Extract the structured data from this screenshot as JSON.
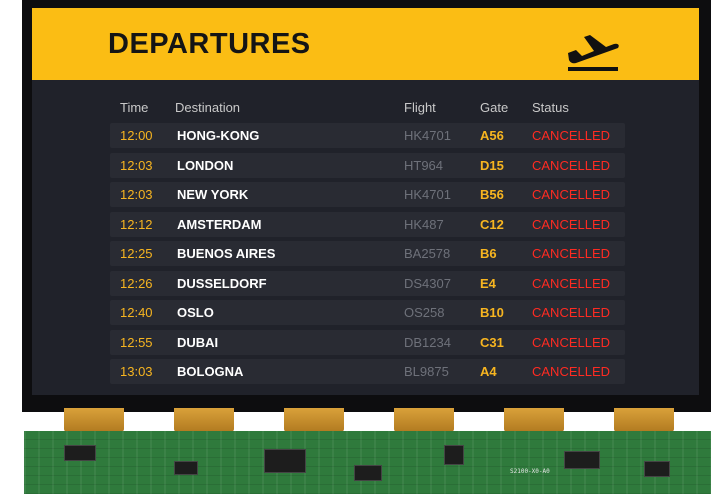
{
  "board": {
    "title": "DEPARTURES",
    "columns": {
      "time": "Time",
      "destination": "Destination",
      "flight": "Flight",
      "gate": "Gate",
      "status": "Status"
    },
    "rows": [
      {
        "time": "12:00",
        "destination": "HONG-KONG",
        "flight": "HK4701",
        "gate": "A56",
        "status": "CANCELLED"
      },
      {
        "time": "12:03",
        "destination": "LONDON",
        "flight": "HT964",
        "gate": "D15",
        "status": "CANCELLED"
      },
      {
        "time": "12:03",
        "destination": "NEW YORK",
        "flight": "HK4701",
        "gate": "B56",
        "status": "CANCELLED"
      },
      {
        "time": "12:12",
        "destination": "AMSTERDAM",
        "flight": "HK487",
        "gate": "C12",
        "status": "CANCELLED"
      },
      {
        "time": "12:25",
        "destination": "BUENOS AIRES",
        "flight": "BA2578",
        "gate": "B6",
        "status": "CANCELLED"
      },
      {
        "time": "12:26",
        "destination": "DUSSELDORF",
        "flight": "DS4307",
        "gate": "E4",
        "status": "CANCELLED"
      },
      {
        "time": "12:40",
        "destination": "OSLO",
        "flight": "OS258",
        "gate": "B10",
        "status": "CANCELLED"
      },
      {
        "time": "12:55",
        "destination": "DUBAI",
        "flight": "DB1234",
        "gate": "C31",
        "status": "CANCELLED"
      },
      {
        "time": "13:03",
        "destination": "BOLOGNA",
        "flight": "BL9875",
        "gate": "A4",
        "status": "CANCELLED"
      }
    ],
    "icon": "airplane-takeoff-icon"
  },
  "pcb": {
    "label": "S2100-X0-A0"
  },
  "colors": {
    "header": "#fbbd14",
    "screen": "#20222a",
    "time_gate": "#f7b520",
    "status": "#ff2b22",
    "pcb": "#2f7a3c"
  }
}
